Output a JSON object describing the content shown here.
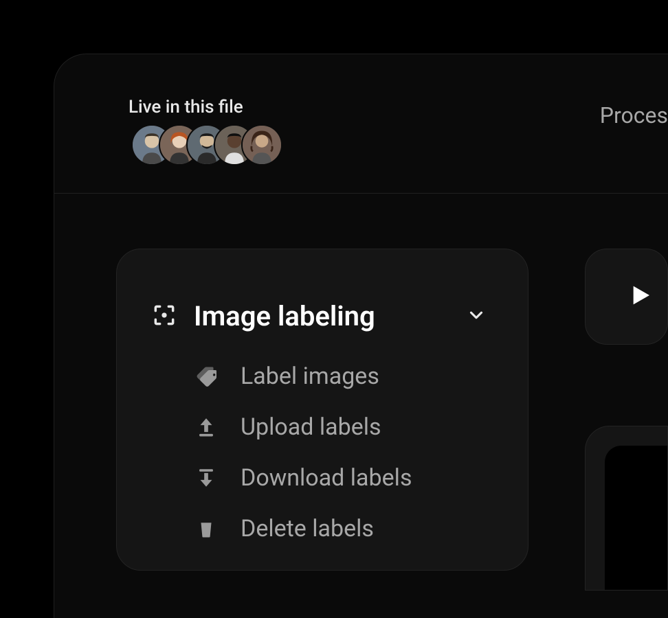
{
  "header": {
    "presence_label": "Live in this file",
    "avatars": [
      {
        "bg": "#6b7a8a",
        "hair": "#3a3228"
      },
      {
        "bg": "#7a6558",
        "hair": "#b85522"
      },
      {
        "bg": "#5f6a72",
        "hair": "#1a1a1a"
      },
      {
        "bg": "#6b6258",
        "hair": "#0f0f0f"
      },
      {
        "bg": "#756055",
        "hair": "#3a2418"
      }
    ],
    "tab_label": "Proces"
  },
  "panel": {
    "title": "Image labeling",
    "items": [
      {
        "icon": "tag",
        "label": "Label images"
      },
      {
        "icon": "upload",
        "label": "Upload labels"
      },
      {
        "icon": "download",
        "label": "Download labels"
      },
      {
        "icon": "trash",
        "label": "Delete labels"
      }
    ]
  }
}
